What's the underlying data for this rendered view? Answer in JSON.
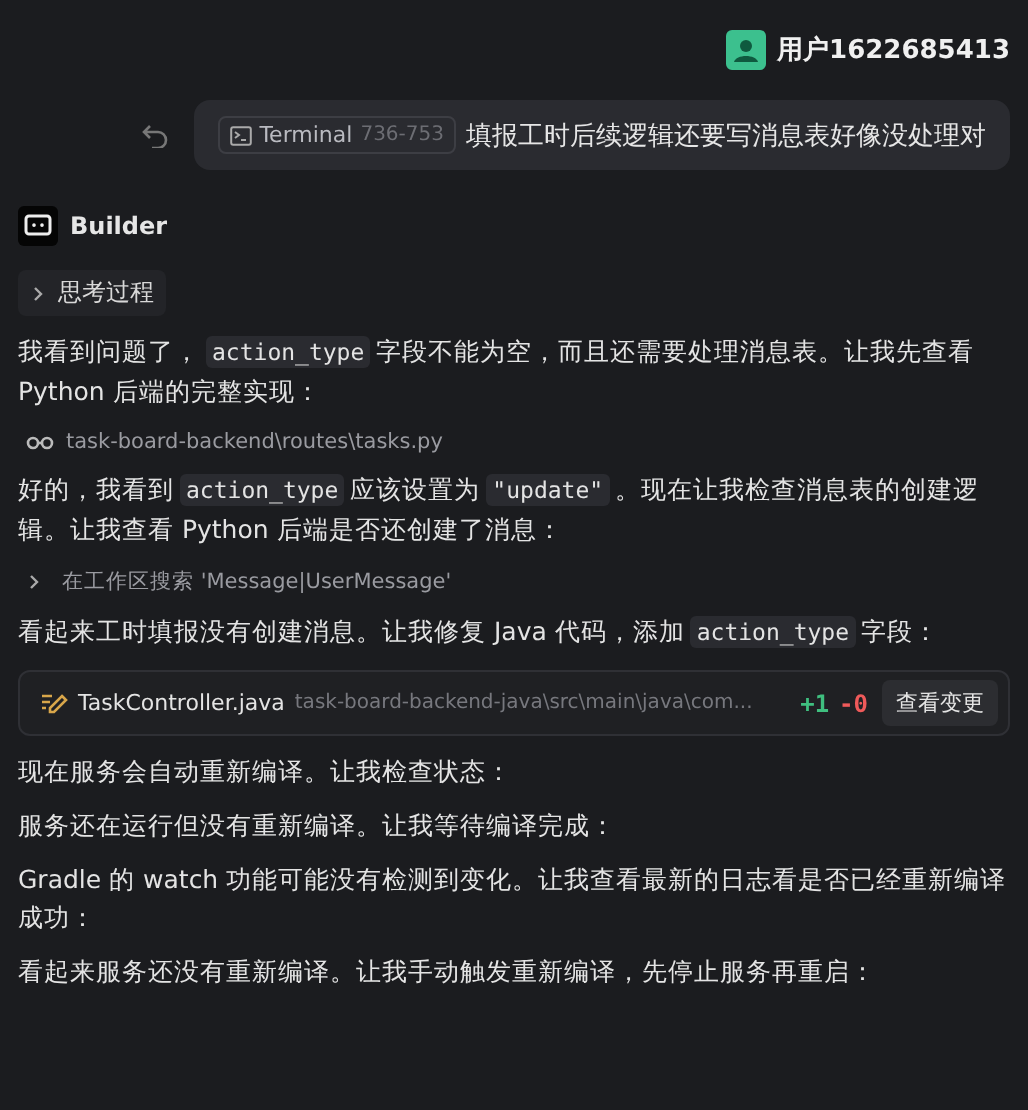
{
  "user": {
    "name": "用户1622685413"
  },
  "user_message": {
    "context_chip": {
      "label": "Terminal",
      "range": "736-753"
    },
    "text": "填报工时后续逻辑还要写消息表好像没处理对"
  },
  "assistant": {
    "name": "Builder"
  },
  "thinking": {
    "label": "思考过程",
    "expanded": false
  },
  "items": [
    {
      "kind": "paragraph",
      "parts": [
        {
          "kind": "text",
          "text": "我看到问题了，"
        },
        {
          "kind": "code",
          "text": "action_type"
        },
        {
          "kind": "text",
          "text": "字段不能为空，而且还需要处理消息表。让我先查看 Python 后端的完整实现："
        }
      ]
    },
    {
      "kind": "file_read",
      "path": "task-board-backend\\routes\\tasks.py"
    },
    {
      "kind": "paragraph",
      "parts": [
        {
          "kind": "text",
          "text": "好的，我看到"
        },
        {
          "kind": "code",
          "text": "action_type"
        },
        {
          "kind": "text",
          "text": "应该设置为"
        },
        {
          "kind": "code",
          "text": "\"update\""
        },
        {
          "kind": "text",
          "text": "。现在让我检查消息表的创建逻辑。让我查看 Python 后端是否还创建了消息："
        }
      ]
    },
    {
      "kind": "search",
      "text": "在工作区搜索 'Message|UserMessage'"
    },
    {
      "kind": "paragraph",
      "parts": [
        {
          "kind": "text",
          "text": "看起来工时填报没有创建消息。让我修复 Java 代码，添加"
        },
        {
          "kind": "code",
          "text": "action_type"
        },
        {
          "kind": "text",
          "text": "字段："
        }
      ]
    },
    {
      "kind": "file_edit",
      "file": "TaskController.java",
      "path": "task-board-backend-java\\src\\main\\java\\com...",
      "added": "+1",
      "removed": "-0",
      "button": "查看变更"
    },
    {
      "kind": "paragraph",
      "parts": [
        {
          "kind": "text",
          "text": "现在服务会自动重新编译。让我检查状态："
        }
      ]
    },
    {
      "kind": "paragraph",
      "parts": [
        {
          "kind": "text",
          "text": "服务还在运行但没有重新编译。让我等待编译完成："
        }
      ]
    },
    {
      "kind": "paragraph",
      "parts": [
        {
          "kind": "text",
          "text": "Gradle 的 watch 功能可能没有检测到变化。让我查看最新的日志看是否已经重新编译成功："
        }
      ]
    },
    {
      "kind": "paragraph",
      "parts": [
        {
          "kind": "text",
          "text": "看起来服务还没有重新编译。让我手动触发重新编译，先停止服务再重启："
        }
      ]
    }
  ]
}
